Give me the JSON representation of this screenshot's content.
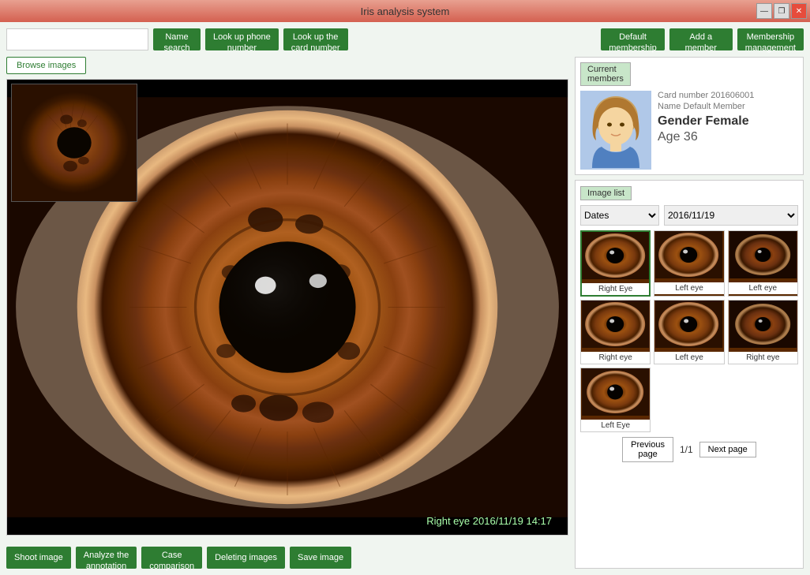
{
  "window": {
    "title": "Iris analysis system",
    "controls": {
      "minimize": "—",
      "restore": "❐",
      "close": "✕"
    }
  },
  "toolbar": {
    "search_placeholder": "",
    "name_search": "Name\nsearch",
    "lookup_phone": "Look up phone\nnumber",
    "lookup_card": "Look up the\ncard number",
    "default_membership": "Default\nmembership",
    "add_member": "Add a\nmember",
    "membership_management": "Membership\nmanagement"
  },
  "left": {
    "browse_images": "Browse images",
    "image_info": "Right eye  2016/11/19 14:17",
    "shoot_image": "Shoot image",
    "analyze_annotation": "Analyze the\nannotation",
    "case_comparison": "Case\ncomparison",
    "deleting_images": "Deleting images",
    "save_image": "Save image"
  },
  "right": {
    "current_members_label": "Current\nmembers",
    "card_number": "Card number 201606001",
    "name_label": "Name Default Member",
    "gender_label": "Gender Female",
    "age_label": "Age 36",
    "image_list_label": "Image list",
    "dates_option": "Dates",
    "date_value": "2016/11/19",
    "thumbnails": [
      {
        "label": "Right Eye",
        "selected": true
      },
      {
        "label": "Left eye",
        "selected": false
      },
      {
        "label": "Left eye",
        "selected": false
      },
      {
        "label": "Right eye",
        "selected": false
      },
      {
        "label": "Left eye",
        "selected": false
      },
      {
        "label": "Right eye",
        "selected": false
      },
      {
        "label": "Left Eye",
        "selected": false
      }
    ],
    "pagination": {
      "previous": "Previous\npage",
      "page_info": "1/1",
      "next": "Next page"
    }
  }
}
